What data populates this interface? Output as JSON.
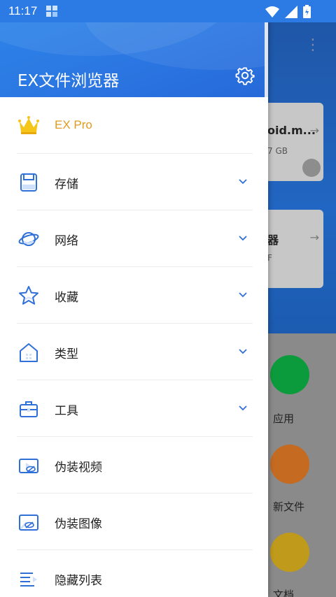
{
  "status_bar": {
    "time": "11:17"
  },
  "drawer": {
    "title": "EX文件浏览器",
    "items": [
      {
        "label": "EX Pro",
        "icon": "crown-icon",
        "has_chevron": false
      },
      {
        "label": "存储",
        "icon": "storage-icon",
        "has_chevron": true
      },
      {
        "label": "网络",
        "icon": "planet-icon",
        "has_chevron": true
      },
      {
        "label": "收藏",
        "icon": "star-icon",
        "has_chevron": true
      },
      {
        "label": "类型",
        "icon": "house-icon",
        "has_chevron": true
      },
      {
        "label": "工具",
        "icon": "toolbox-icon",
        "has_chevron": true
      },
      {
        "label": "伪装视频",
        "icon": "hidden-video-icon",
        "has_chevron": false
      },
      {
        "label": "伪装图像",
        "icon": "hidden-image-icon",
        "has_chevron": false
      },
      {
        "label": "隐藏列表",
        "icon": "hidden-list-icon",
        "has_chevron": false
      }
    ]
  },
  "background": {
    "card1_title": "oid.m...",
    "card1_sub": "7 GB",
    "card2_title": "器",
    "card2_sub": "F",
    "tiles": [
      "应用",
      "新文件",
      "文档"
    ]
  },
  "colors": {
    "accent": "#2b77e2",
    "pro": "#e39a1f",
    "icon_blue": "#2f6fd8",
    "crown": "#f5c518"
  }
}
